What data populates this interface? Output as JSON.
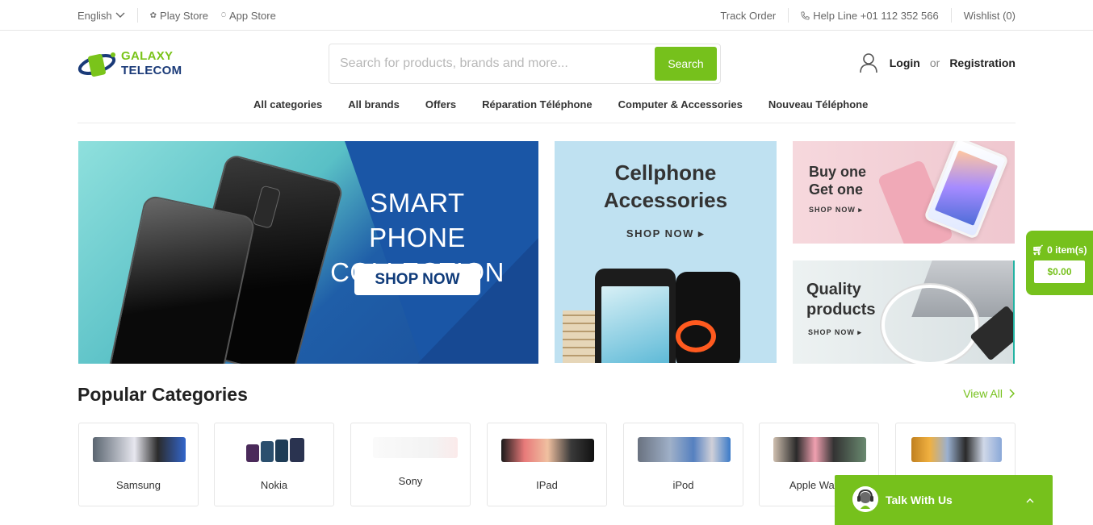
{
  "topbar": {
    "language": "English",
    "play_store": "Play Store",
    "app_store": "App Store",
    "track_order": "Track Order",
    "help_line": "Help Line +01 112 352 566",
    "wishlist": "Wishlist (0)"
  },
  "logo": {
    "line1": "GALAXY",
    "line2": "TELECOM"
  },
  "search": {
    "placeholder": "Search for products, brands and more...",
    "button": "Search"
  },
  "account": {
    "login": "Login",
    "or": "or",
    "register": "Registration"
  },
  "nav": [
    "All categories",
    "All brands",
    "Offers",
    "Réparation Téléphone",
    "Computer & Accessories",
    "Nouveau Téléphone"
  ],
  "banners": {
    "main": {
      "line1": "SMART PHONE",
      "line2": "COLLECTION",
      "cta": "SHOP NOW"
    },
    "accessories": {
      "line1": "Cellphone",
      "line2": "Accessories",
      "cta": "SHOP NOW ▸"
    },
    "bogo": {
      "line1": "Buy one",
      "line2": "Get one",
      "cta": "SHOP NOW ▸"
    },
    "quality": {
      "line1": "Quality",
      "line2": "products",
      "cta": "SHOP NOW ▸"
    }
  },
  "popular": {
    "title": "Popular Categories",
    "view_all": "View All",
    "categories": [
      {
        "name": "Samsung"
      },
      {
        "name": "Nokia"
      },
      {
        "name": "Sony"
      },
      {
        "name": "IPad"
      },
      {
        "name": "iPod"
      },
      {
        "name": "Apple Watch"
      },
      {
        "name": ""
      }
    ]
  },
  "cart": {
    "items": "0 item(s)",
    "total": "$0.00"
  },
  "chat": {
    "label": "Talk With Us"
  },
  "colors": {
    "brand_green": "#76c11c",
    "brand_navy": "#1a3a78"
  }
}
